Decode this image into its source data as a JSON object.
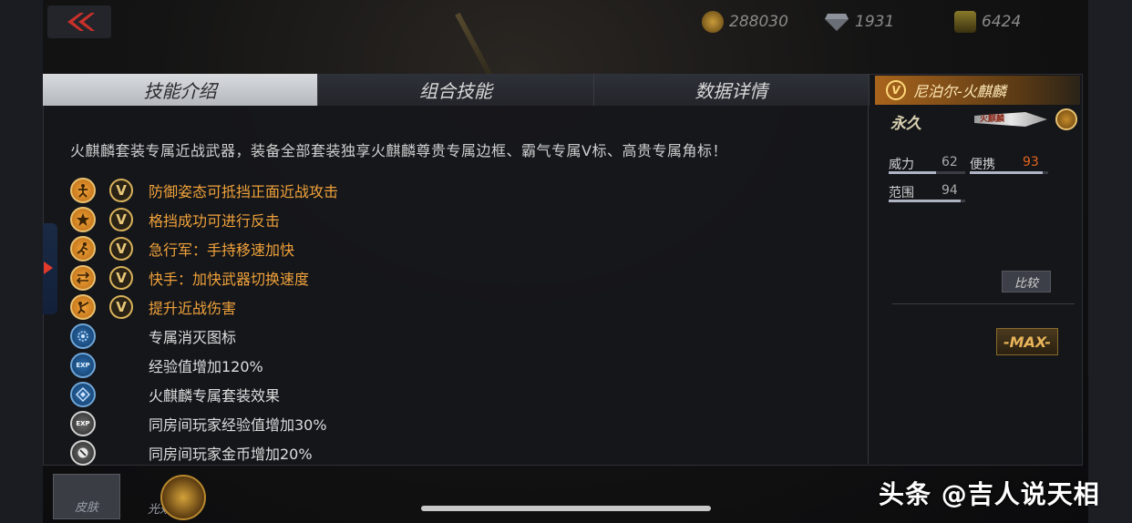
{
  "header": {
    "currencies": [
      {
        "icon": "gold-coin-icon",
        "value": "288030"
      },
      {
        "icon": "diamond-icon",
        "value": "1931"
      },
      {
        "icon": "crossed-swords-icon",
        "value": "6424"
      }
    ]
  },
  "tabs": [
    {
      "label": "技能介绍",
      "active": true
    },
    {
      "label": "组合技能",
      "active": false
    },
    {
      "label": "数据详情",
      "active": false
    }
  ],
  "skills": {
    "description": "火麒麟套装专属近战武器，装备全部套装独享火麒麟尊贵专属边框、霸气专属V标、高贵专属角标！",
    "features": [
      {
        "icon": "defense-stance-icon",
        "tier": "gold",
        "vip": true,
        "text": "防御姿态可抵挡正面近战攻击"
      },
      {
        "icon": "star-icon",
        "tier": "gold",
        "vip": true,
        "text": "格挡成功可进行反击"
      },
      {
        "icon": "running-icon",
        "tier": "gold",
        "vip": true,
        "text": "急行军：手持移速加快"
      },
      {
        "icon": "weapon-swap-icon",
        "tier": "gold",
        "vip": true,
        "text": "快手：加快武器切换速度"
      },
      {
        "icon": "melee-attack-icon",
        "tier": "gold",
        "vip": true,
        "text": "提升近战伤害"
      },
      {
        "icon": "kill-icon-emblem",
        "tier": "blue",
        "vip": false,
        "text": "专属消灭图标"
      },
      {
        "icon": "exp-icon",
        "tier": "blue",
        "vip": false,
        "text": "经验值增加120%"
      },
      {
        "icon": "suit-effect-icon",
        "tier": "blue",
        "vip": false,
        "text": "火麒麟专属套装效果"
      },
      {
        "icon": "room-exp-icon",
        "tier": "silver",
        "vip": false,
        "text": "同房间玩家经验值增加30%"
      },
      {
        "icon": "room-coin-icon",
        "tier": "silver",
        "vip": false,
        "text": "同房间玩家金币增加20%"
      }
    ],
    "vip_mark": "V"
  },
  "weapon": {
    "name": "尼泊尔-火麒麟",
    "duration": "永久",
    "label": "火麒麟",
    "stats": [
      {
        "label": "威力",
        "value": "62",
        "fraction": 0.62,
        "color": "#aaaaaa"
      },
      {
        "label": "便携",
        "value": "93",
        "fraction": 0.93,
        "color": "#e0641e"
      },
      {
        "label": "范围",
        "value": "94",
        "fraction": 0.94,
        "color": "#aaaaaa"
      }
    ],
    "compare_label": "比较",
    "max_label": "-MAX-"
  },
  "bottom": {
    "skin_label": "皮肤",
    "light_label": "光效"
  },
  "watermark": "头条 @吉人说天相"
}
